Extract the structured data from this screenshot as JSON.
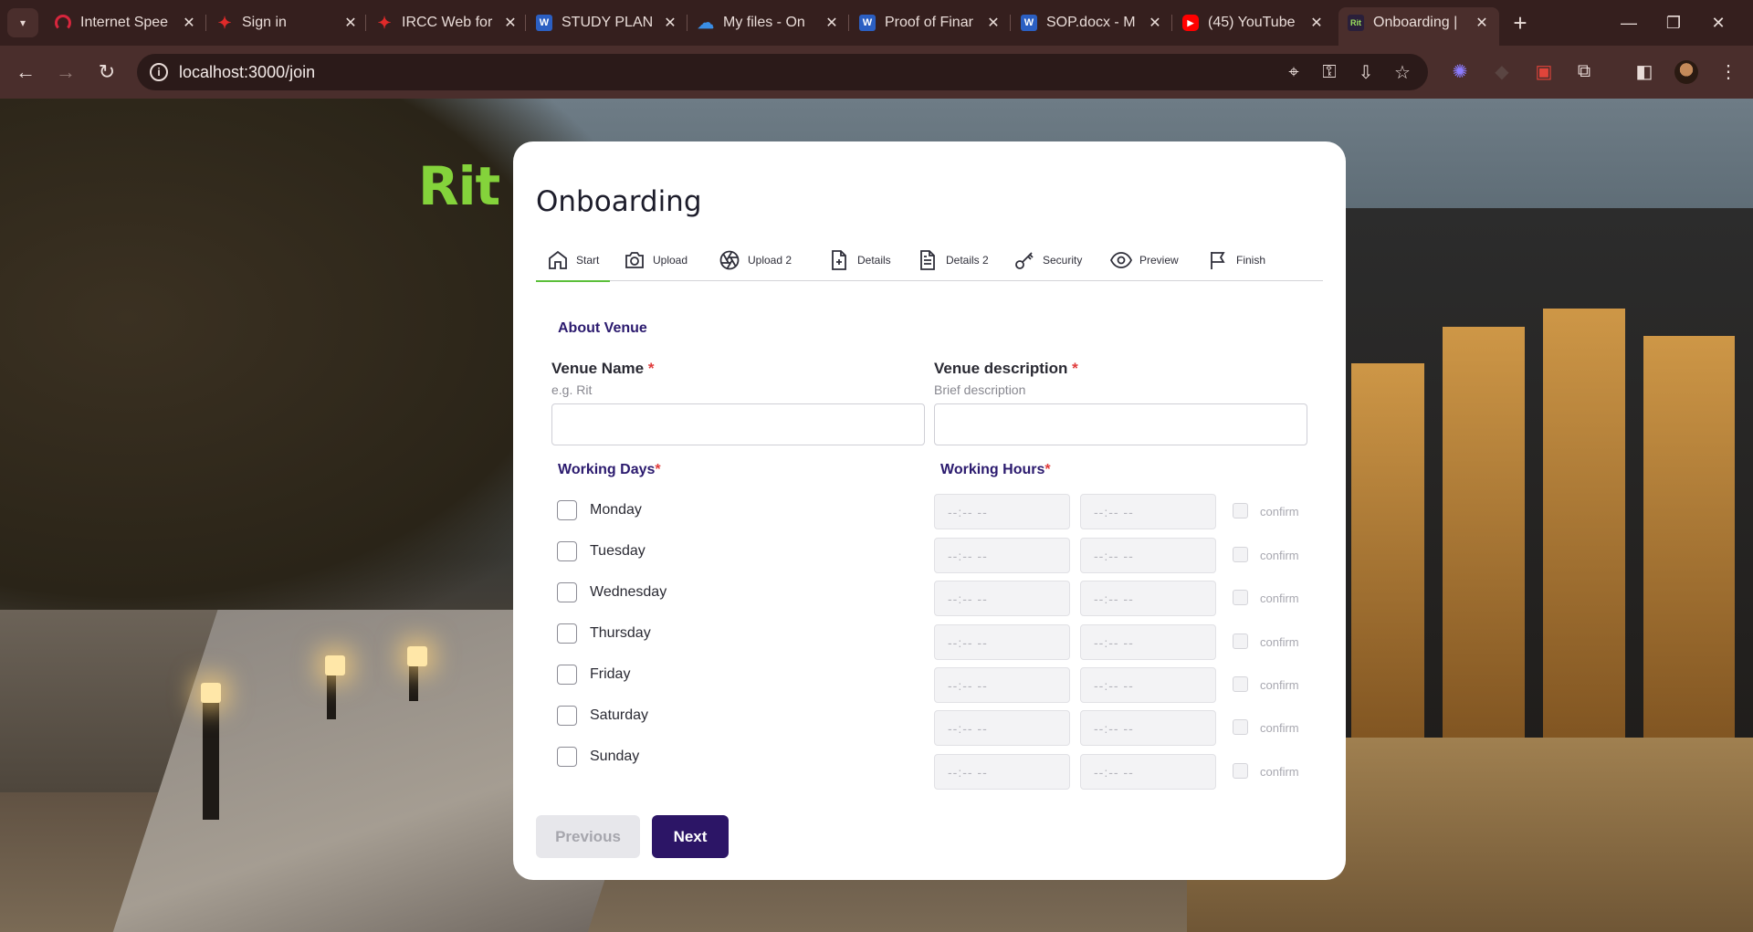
{
  "browser": {
    "tabs": [
      {
        "title": "Internet Spee",
        "favicon": "speedometer-icon"
      },
      {
        "title": "Sign in",
        "favicon": "maple-leaf-icon"
      },
      {
        "title": "IRCC Web for",
        "favicon": "maple-leaf-icon"
      },
      {
        "title": "STUDY PLAN",
        "favicon": "word-icon"
      },
      {
        "title": "My files - On",
        "favicon": "onedrive-icon"
      },
      {
        "title": "Proof of Finar",
        "favicon": "word-icon"
      },
      {
        "title": "SOP.docx - M",
        "favicon": "word-icon"
      },
      {
        "title": "(45) YouTube",
        "favicon": "youtube-icon"
      },
      {
        "title": "Onboarding |",
        "favicon": "rit-icon"
      }
    ],
    "favicon_word_text": "W",
    "favicon_yt_text": "▶",
    "favicon_rit_text": "Rit",
    "url": "localhost:3000/join"
  },
  "brand": {
    "logo_text": "Rit",
    "accent_color": "#84d33b"
  },
  "page": {
    "title": "Onboarding",
    "steps": [
      {
        "label": "Start",
        "icon": "home-icon",
        "active": true
      },
      {
        "label": "Upload",
        "icon": "camera-icon",
        "active": false
      },
      {
        "label": "Upload 2",
        "icon": "aperture-icon",
        "active": false
      },
      {
        "label": "Details",
        "icon": "file-plus-icon",
        "active": false
      },
      {
        "label": "Details 2",
        "icon": "file-text-icon",
        "active": false
      },
      {
        "label": "Security",
        "icon": "key-icon",
        "active": false
      },
      {
        "label": "Preview",
        "icon": "eye-icon",
        "active": false
      },
      {
        "label": "Finish",
        "icon": "flag-icon",
        "active": false
      }
    ],
    "section_about": "About Venue",
    "venue_name": {
      "label": "Venue Name",
      "required_mark": "*",
      "hint": "e.g. Rit",
      "value": ""
    },
    "venue_description": {
      "label": "Venue description",
      "required_mark": "*",
      "hint": "Brief description",
      "value": ""
    },
    "working_days": {
      "label": "Working Days",
      "required_mark": "*"
    },
    "working_hours": {
      "label": "Working Hours",
      "required_mark": "*"
    },
    "days": [
      "Monday",
      "Tuesday",
      "Wednesday",
      "Thursday",
      "Friday",
      "Saturday",
      "Sunday"
    ],
    "time_placeholder": "--:-- --",
    "confirm_label": "confirm",
    "buttons": {
      "previous": "Previous",
      "next": "Next"
    },
    "colors": {
      "primary": "#2c1566",
      "active_step": "#5bbf3a",
      "required": "#e03b3b",
      "section": "#2b1a6e"
    }
  }
}
